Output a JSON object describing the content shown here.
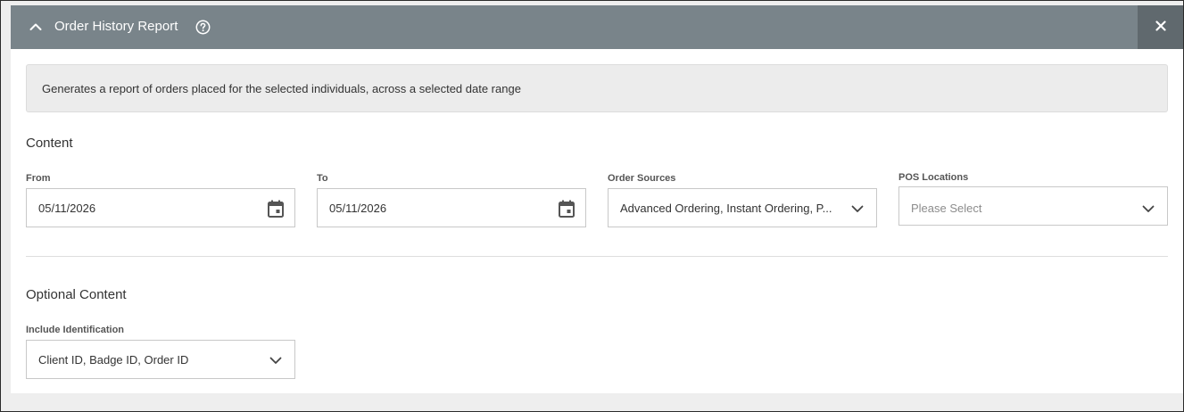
{
  "header": {
    "title": "Order History Report",
    "collapse_icon": "chevron-up-icon",
    "help_icon": "help-circle-icon",
    "close_icon": "close-icon"
  },
  "description": "Generates a report of orders placed for the selected individuals, across a selected date range",
  "content": {
    "title": "Content",
    "from": {
      "label": "From",
      "value": "05/11/2026",
      "icon": "calendar-icon"
    },
    "to": {
      "label": "To",
      "value": "05/11/2026",
      "icon": "calendar-icon"
    },
    "order_sources": {
      "label": "Order Sources",
      "value": "Advanced Ordering, Instant Ordering, P...",
      "icon": "chevron-down-icon"
    },
    "pos_locations": {
      "label": "POS Locations",
      "placeholder": "Please Select",
      "icon": "chevron-down-icon"
    }
  },
  "optional_content": {
    "title": "Optional Content",
    "include_identification": {
      "label": "Include Identification",
      "value": "Client ID, Badge ID, Order ID",
      "icon": "chevron-down-icon"
    }
  },
  "colors": {
    "header_bg": "#79848a",
    "close_bg": "#60696e",
    "description_bg": "#ececec",
    "border": "#c8c8c8"
  }
}
